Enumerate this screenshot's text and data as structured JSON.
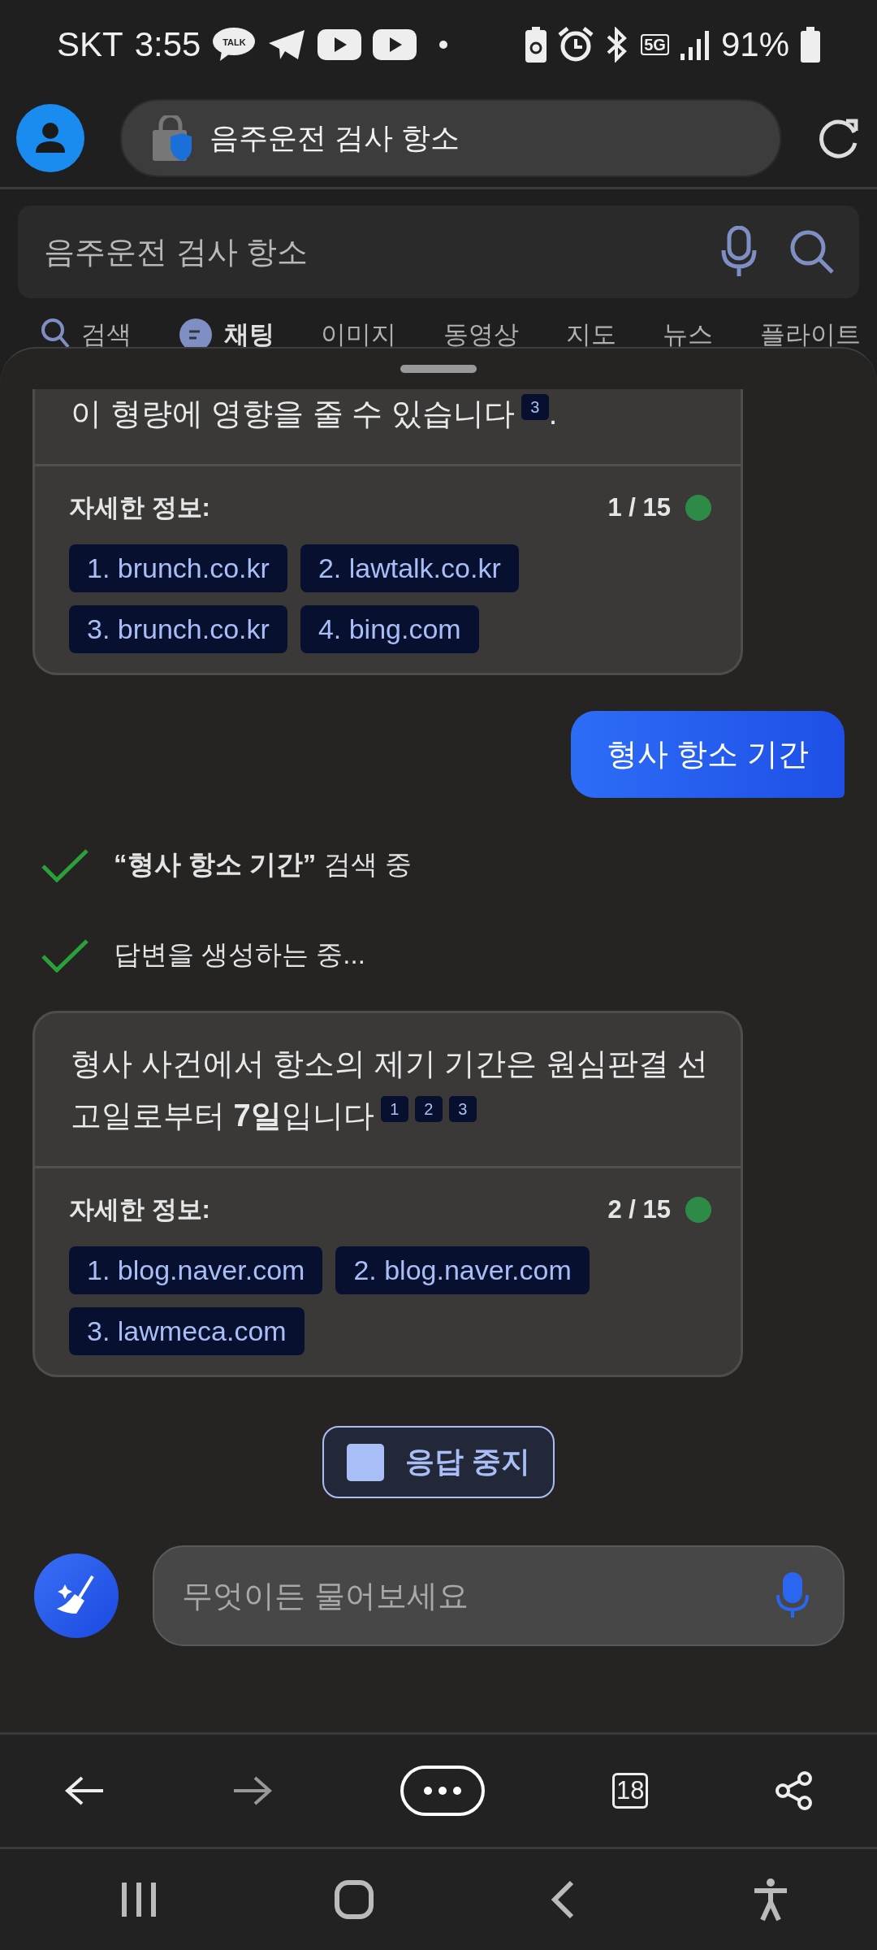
{
  "status_bar": {
    "carrier": "SKT",
    "time": "3:55",
    "talk_label": "TALK",
    "network": "5G",
    "battery": "91%"
  },
  "browser": {
    "url": "음주운전 검사 항소"
  },
  "search": {
    "value": "음주운전 검사 항소"
  },
  "tabs": [
    {
      "label": "검색",
      "kind": "search",
      "selected": false
    },
    {
      "label": "채팅",
      "kind": "chat",
      "selected": true
    },
    {
      "label": "이미지",
      "selected": false
    },
    {
      "label": "동영상",
      "selected": false
    },
    {
      "label": "지도",
      "selected": false
    },
    {
      "label": "뉴스",
      "selected": false
    },
    {
      "label": "플라이트",
      "selected": false
    }
  ],
  "messages": [
    {
      "kind": "answer",
      "text": "이 형량에 영향을 줄 수 있습니다",
      "citations": [
        "3"
      ],
      "trailing": ".",
      "more_label": "자세한 정보:",
      "counter": "1 / 15",
      "sources": [
        "1. brunch.co.kr",
        "2. lawtalk.co.kr",
        "3. brunch.co.kr",
        "4. bing.com"
      ]
    },
    {
      "kind": "user",
      "text": "형사 항소 기간"
    },
    {
      "kind": "status",
      "text": "**“형사 항소 기간”** 검색 중",
      "done": true
    },
    {
      "kind": "status",
      "text": "답변을 생성하는 중...",
      "done": true
    },
    {
      "kind": "answer",
      "text": "형사 사건에서 항소의 제기 기간은 원심판결 선고일로부터 **7일**입니다",
      "citations": [
        "1",
        "2",
        "3"
      ],
      "more_label": "자세한 정보:",
      "counter": "2 / 15",
      "sources": [
        "1. blog.naver.com",
        "2. blog.naver.com",
        "3. lawmeca.com"
      ]
    }
  ],
  "stop_button": "응답 중지",
  "composer": {
    "placeholder": "무엇이든 물어보세요"
  },
  "toolbar": {
    "tab_count": "18"
  }
}
